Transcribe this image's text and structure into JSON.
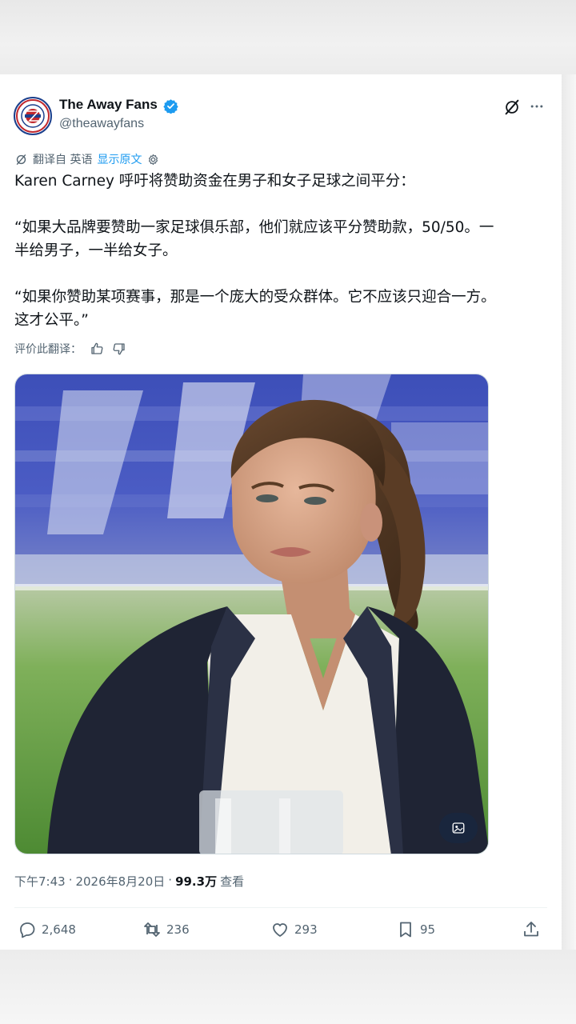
{
  "author": {
    "display_name": "The Away Fans",
    "handle": "@theawayfans",
    "verified": true,
    "avatar_icon": "club-crest-avatar"
  },
  "header_icons": [
    "grok-icon",
    "more-icon"
  ],
  "translation": {
    "label": "翻译自 英语",
    "show_original": "显示原文",
    "settings_icon": "gear-icon"
  },
  "tweet": {
    "paragraphs": [
      "Karen Carney 呼吁将赞助资金在男子和女子足球之间平分：",
      "“如果大品牌要赞助一家足球俱乐部，他们就应该平分赞助款，50/50。一\n半给男子，一半给女子。",
      "“如果你赞助某项赛事，那是一个庞大的受众群体。它不应该只迎合一方。\n这才公平。”"
    ]
  },
  "rate_translation": {
    "label": "评价此翻译："
  },
  "media": {
    "alt_icon": "image-description-icon"
  },
  "meta": {
    "time": "下午7:43",
    "sep": "·",
    "date": "2026年8月20日",
    "views": "99.3万",
    "views_label": "查看"
  },
  "actions": {
    "replies": "2,648",
    "retweets": "236",
    "likes": "293",
    "bookmarks": "95"
  },
  "colors": {
    "accent": "#1d9bf0",
    "text": "#0f1419",
    "secondary": "#536471"
  }
}
